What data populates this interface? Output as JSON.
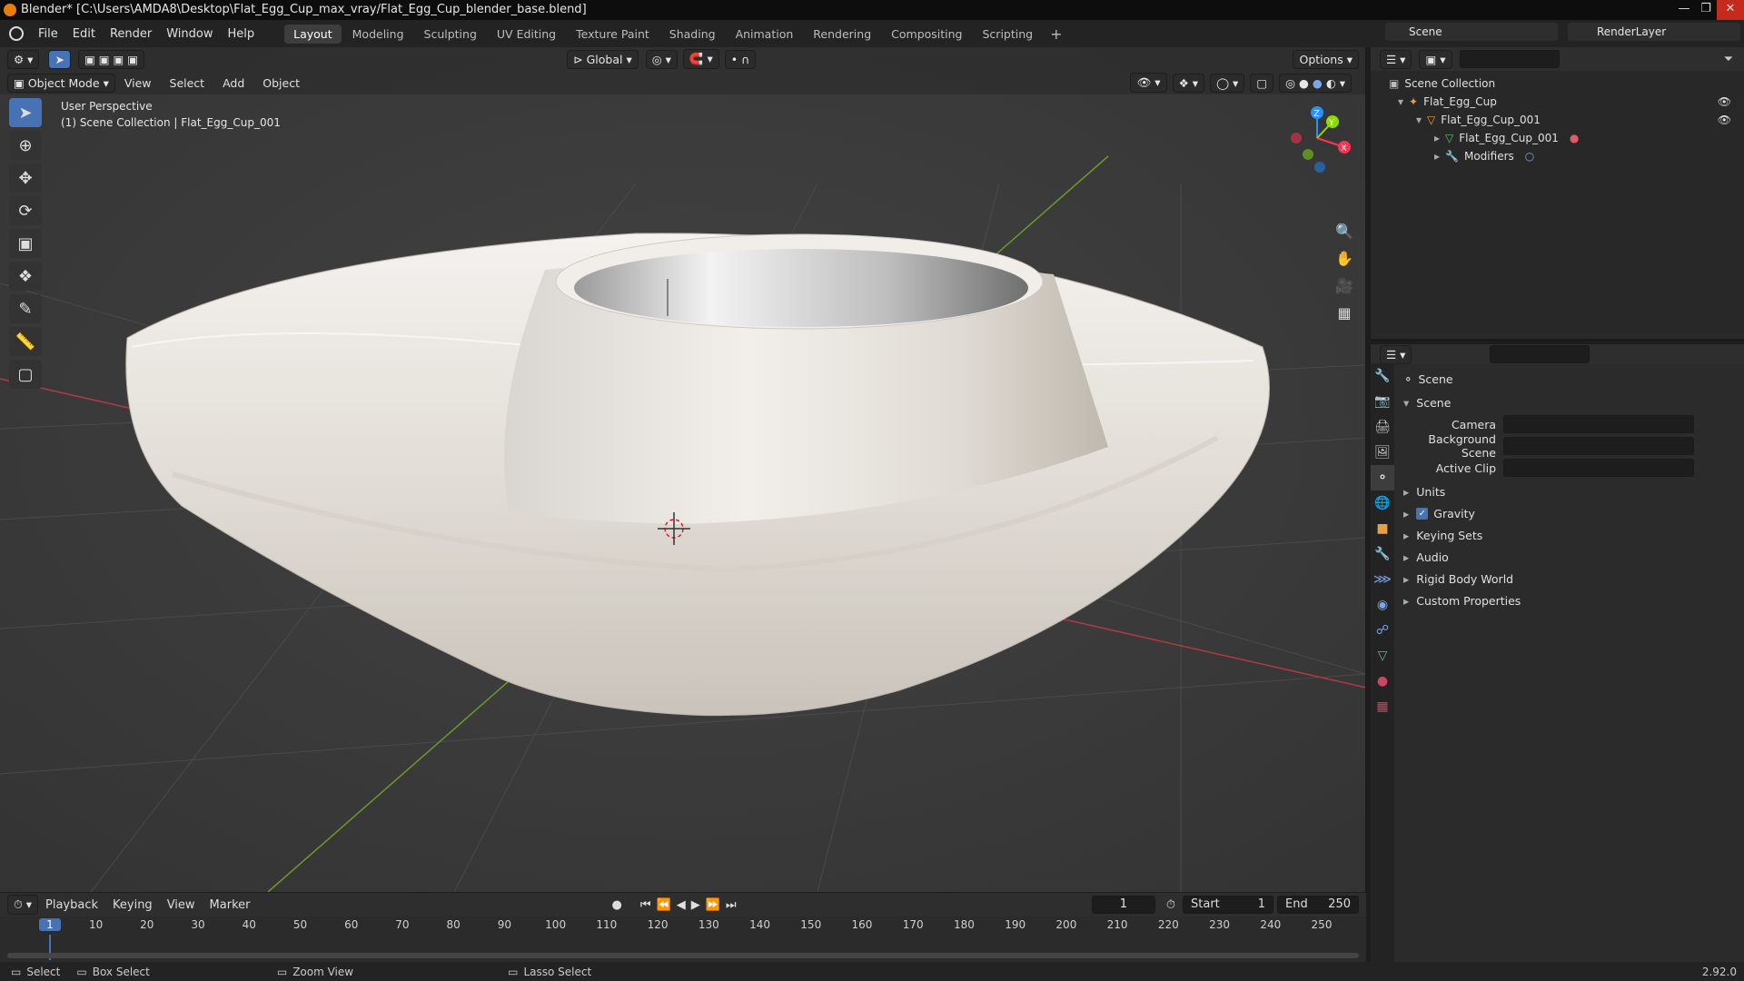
{
  "window": {
    "title": "Blender* [C:\\Users\\AMDA8\\Desktop\\Flat_Egg_Cup_max_vray/Flat_Egg_Cup_blender_base.blend]"
  },
  "menu": [
    "File",
    "Edit",
    "Render",
    "Window",
    "Help"
  ],
  "workspaces": [
    "Layout",
    "Modeling",
    "Sculpting",
    "UV Editing",
    "Texture Paint",
    "Shading",
    "Animation",
    "Rendering",
    "Compositing",
    "Scripting"
  ],
  "active_workspace": "Layout",
  "scene_name": "Scene",
  "render_layer": "RenderLayer",
  "viewport": {
    "transform_orientation": "Global",
    "options_label": "Options",
    "mode": "Object Mode",
    "header_menus": [
      "View",
      "Select",
      "Add",
      "Object"
    ],
    "perspective_label": "User Perspective",
    "collection_label": "(1) Scene Collection | Flat_Egg_Cup_001",
    "gizmo_axes": {
      "x": "X",
      "y": "Y",
      "z": "Z"
    }
  },
  "outliner": {
    "root": "Scene Collection",
    "items": [
      "Flat_Egg_Cup",
      "Flat_Egg_Cup_001",
      "Flat_Egg_Cup_001",
      "Modifiers"
    ]
  },
  "properties": {
    "header": "Scene",
    "panel_title": "Scene",
    "fields": [
      "Camera",
      "Background Scene",
      "Active Clip"
    ],
    "sections": [
      "Units",
      "Gravity",
      "Keying Sets",
      "Audio",
      "Rigid Body World",
      "Custom Properties"
    ],
    "gravity_checked": true
  },
  "timeline": {
    "menus": [
      "Playback",
      "Keying",
      "View",
      "Marker"
    ],
    "current_frame": "1",
    "start_label": "Start",
    "start_value": "1",
    "end_label": "End",
    "end_value": "250",
    "ticks": [
      "1",
      "10",
      "20",
      "30",
      "40",
      "50",
      "60",
      "70",
      "80",
      "90",
      "100",
      "110",
      "120",
      "130",
      "140",
      "150",
      "160",
      "170",
      "180",
      "190",
      "200",
      "210",
      "220",
      "230",
      "240",
      "250"
    ]
  },
  "status": {
    "select": "Select",
    "box_select": "Box Select",
    "zoom_view": "Zoom View",
    "lasso_select": "Lasso Select",
    "version": "2.92.0"
  },
  "colors": {
    "accent": "#4772b3",
    "axis_x": "#ff3352",
    "axis_y": "#8bdc00",
    "axis_z": "#2890ff"
  }
}
